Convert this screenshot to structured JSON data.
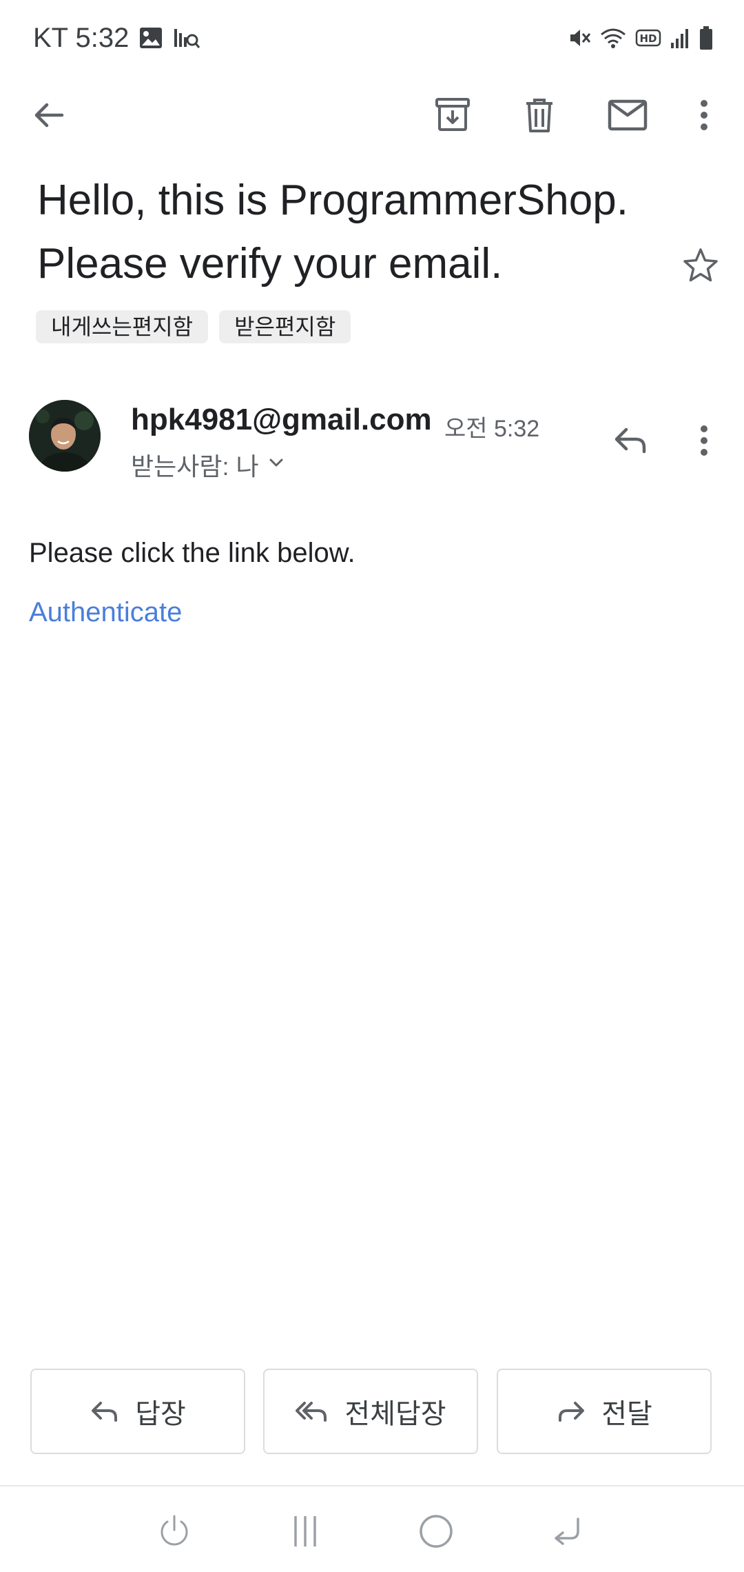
{
  "status_bar": {
    "carrier_time": "KT 5:32",
    "icons": [
      "gallery-icon",
      "scan-search-icon",
      "mute-icon",
      "wifi-icon",
      "hd-voice-icon",
      "signal-icon",
      "battery-icon"
    ]
  },
  "toolbar": {
    "icons": [
      "back-arrow-icon",
      "archive-icon",
      "delete-icon",
      "mark-unread-icon",
      "more-vert-icon"
    ]
  },
  "email": {
    "subject_line1": "Hello, this is ProgrammerShop.",
    "subject_line2": "Please verify your email.",
    "labels": [
      "내게쓰는편지함",
      "받은편지함"
    ],
    "sender_email": "hpk4981@gmail.com",
    "time": "오전 5:32",
    "recipient": "받는사람: 나",
    "body_text": "Please click the link below.",
    "link_text": "Authenticate"
  },
  "actions": {
    "reply": "답장",
    "reply_all": "전체답장",
    "forward": "전달"
  },
  "colors": {
    "link": "#4a7fd9",
    "icon_gray": "#5f6368",
    "chip_bg": "#eeeeee"
  },
  "nav_bar": {
    "icons": [
      "power-icon",
      "recent-apps-icon",
      "home-icon",
      "back-icon"
    ]
  }
}
